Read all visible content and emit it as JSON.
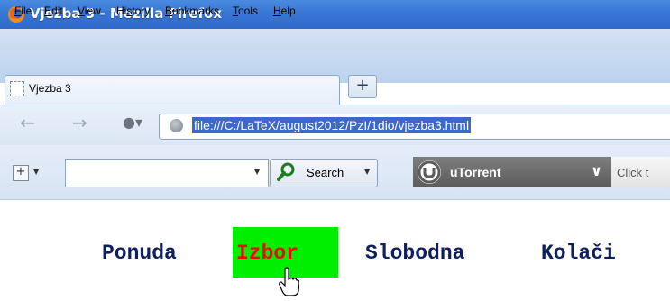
{
  "window": {
    "title": "Vjezba 3 - Mozilla Firefox"
  },
  "menu": {
    "items": [
      {
        "pre": "",
        "ul": "F",
        "post": "ile"
      },
      {
        "pre": "",
        "ul": "E",
        "post": "dit"
      },
      {
        "pre": "",
        "ul": "V",
        "post": "iew"
      },
      {
        "pre": "Hi",
        "ul": "s",
        "post": "tory"
      },
      {
        "pre": "",
        "ul": "B",
        "post": "ookmarks"
      },
      {
        "pre": "",
        "ul": "T",
        "post": "ools"
      },
      {
        "pre": "",
        "ul": "H",
        "post": "elp"
      }
    ]
  },
  "tabs": {
    "active_label": "Vjezba 3",
    "new_tab_label": "+"
  },
  "navigation": {
    "url": "file:///C:/LaTeX/august2012/PzI/1dio/vjezba3.html"
  },
  "search": {
    "button_label": "Search",
    "value": ""
  },
  "utorrent": {
    "label": "uTorrent",
    "right_text": "Click t"
  },
  "page": {
    "links": [
      {
        "label": "Ponuda",
        "hovered": false
      },
      {
        "label": "Izbor",
        "hovered": true,
        "color": "#ff0000",
        "bg": "#00ee00"
      },
      {
        "label": "Slobodna",
        "hovered": false
      },
      {
        "label": "Kolači",
        "hovered": false
      }
    ]
  }
}
